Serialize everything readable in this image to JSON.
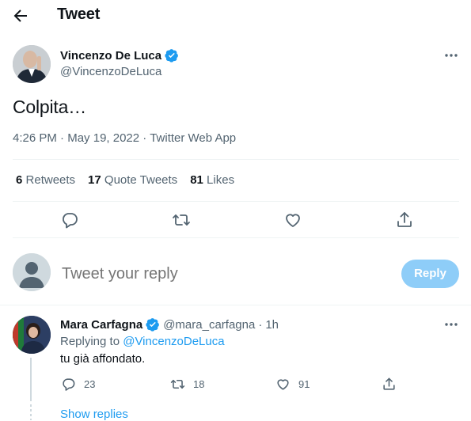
{
  "header": {
    "title": "Tweet"
  },
  "tweet": {
    "author_name": "Vincenzo De Luca",
    "author_handle": "@VincenzoDeLuca",
    "text": "Colpita…",
    "time": "4:26 PM",
    "date": "May 19, 2022",
    "source": "Twitter Web App",
    "separator": "·",
    "stats": {
      "retweets_count": "6",
      "retweets_label": "Retweets",
      "quotes_count": "17",
      "quotes_label": "Quote Tweets",
      "likes_count": "81",
      "likes_label": "Likes"
    }
  },
  "composer": {
    "placeholder": "Tweet your reply",
    "button_label": "Reply"
  },
  "reply": {
    "author_name": "Mara Carfagna",
    "author_handle": "@mara_carfagna",
    "separator": "·",
    "time": "1h",
    "replying_to_label": "Replying to",
    "replying_to_handle": "@VincenzoDeLuca",
    "text": "tu già affondato.",
    "reply_count": "23",
    "retweet_count": "18",
    "like_count": "91"
  },
  "show_replies_label": "Show replies",
  "colors": {
    "accent": "#1d9bf0",
    "reply_button": "#8ecdf8",
    "secondary_text": "#536471",
    "divider": "#eff3f4"
  },
  "icons": [
    "back-arrow-icon",
    "verified-badge-icon",
    "more-icon",
    "reply-icon",
    "retweet-icon",
    "like-icon",
    "share-icon"
  ]
}
